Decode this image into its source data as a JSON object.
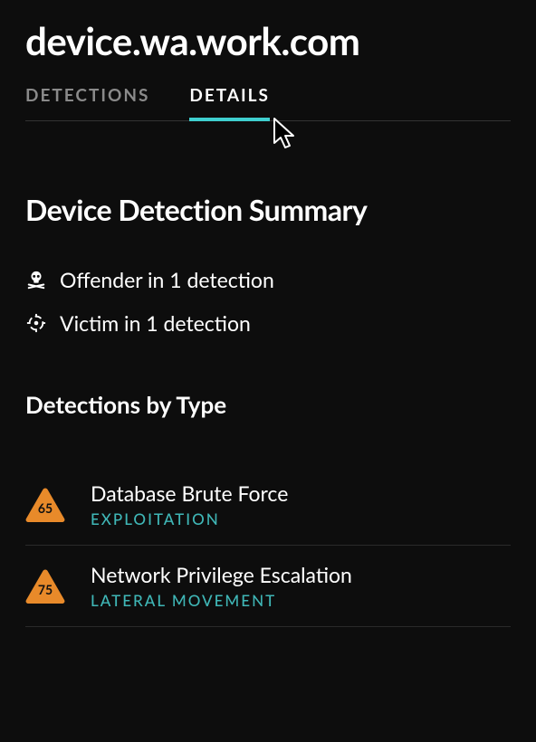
{
  "page_title": "device.wa.work.com",
  "tabs": {
    "detections": "DETECTIONS",
    "details": "DETAILS"
  },
  "summary": {
    "heading": "Device Detection Summary",
    "offender_label": "Offender in 1 detection",
    "victim_label": "Victim in 1 detection"
  },
  "by_type": {
    "heading": "Detections by Type",
    "items": [
      {
        "score": "65",
        "name": "Database Brute Force",
        "category": "EXPLOITATION"
      },
      {
        "score": "75",
        "name": "Network Privilege Escalation",
        "category": "LATERAL MOVEMENT"
      }
    ]
  },
  "colors": {
    "accent": "#3fcfcf",
    "category_text": "#3fb6b6",
    "badge_fill": "#e88a2a"
  }
}
